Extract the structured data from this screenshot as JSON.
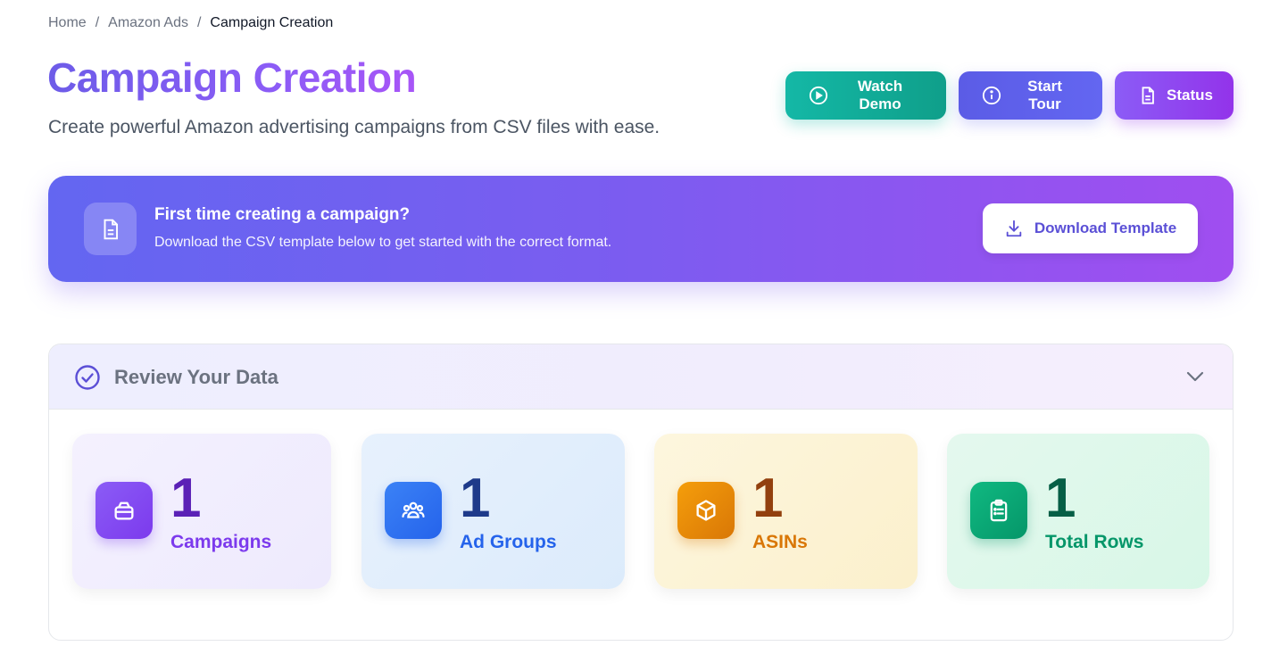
{
  "breadcrumb": {
    "items": [
      "Home",
      "Amazon Ads",
      "Campaign Creation"
    ],
    "separator": "/"
  },
  "header": {
    "title": "Campaign Creation",
    "subtitle": "Create powerful Amazon advertising campaigns from CSV files with ease.",
    "actions": {
      "watch_demo": {
        "label": "Watch Demo",
        "icon": "play-circle-icon",
        "color": "#14b8a6"
      },
      "start_tour": {
        "label": "Start Tour",
        "icon": "info-circle-icon",
        "color": "#6366f1"
      },
      "status": {
        "label": "Status",
        "icon": "document-icon",
        "color": "#9333ea"
      }
    }
  },
  "banner": {
    "icon": "document-icon",
    "title": "First time creating a campaign?",
    "text": "Download the CSV template below to get started with the correct format.",
    "download_label": "Download Template",
    "download_icon": "download-icon"
  },
  "review": {
    "title": "Review Your Data",
    "icon": "check-circle-icon",
    "expanded": true,
    "stats": [
      {
        "value": "1",
        "label": "Campaigns",
        "icon": "briefcase-icon",
        "color": "#7c3aed"
      },
      {
        "value": "1",
        "label": "Ad Groups",
        "icon": "users-icon",
        "color": "#2563eb"
      },
      {
        "value": "1",
        "label": "ASINs",
        "icon": "cube-icon",
        "color": "#d97706"
      },
      {
        "value": "1",
        "label": "Total Rows",
        "icon": "clipboard-icon",
        "color": "#059669"
      }
    ]
  }
}
